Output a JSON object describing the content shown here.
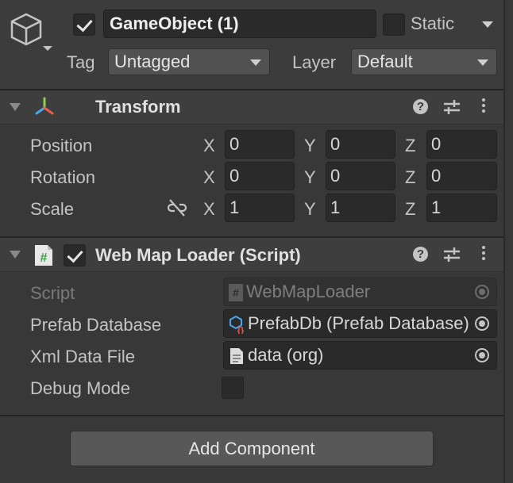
{
  "header": {
    "object_name": "GameObject (1)",
    "active": true,
    "static_label": "Static",
    "static_checked": false,
    "tag_label": "Tag",
    "tag_value": "Untagged",
    "layer_label": "Layer",
    "layer_value": "Default",
    "icon": "cube-icon"
  },
  "transform": {
    "title": "Transform",
    "icon": "transform-axes-icon",
    "rows": [
      {
        "label": "Position",
        "x": "0",
        "y": "0",
        "z": "0"
      },
      {
        "label": "Rotation",
        "x": "0",
        "y": "0",
        "z": "0"
      },
      {
        "label": "Scale",
        "x": "1",
        "y": "1",
        "z": "1"
      }
    ],
    "axes": {
      "x": "X",
      "y": "Y",
      "z": "Z"
    }
  },
  "script_component": {
    "title": "Web Map Loader (Script)",
    "enabled": true,
    "icon": "csharp-script-icon",
    "fields": [
      {
        "label": "Script",
        "value": "WebMapLoader",
        "icon": "script-file-icon",
        "disabled": true
      },
      {
        "label": "Prefab Database",
        "value": "PrefabDb (Prefab Database)",
        "icon": "scriptable-object-icon"
      },
      {
        "label": "Xml Data File",
        "value": "data (org)",
        "icon": "text-asset-icon"
      },
      {
        "label": "Debug Mode",
        "value": false
      }
    ]
  },
  "help_glyph": "?",
  "add_component_label": "Add Component",
  "colors": {
    "background": "#383838",
    "field": "#2a2a2a",
    "button": "#585858",
    "script_icon_green": "#3f9b48"
  }
}
